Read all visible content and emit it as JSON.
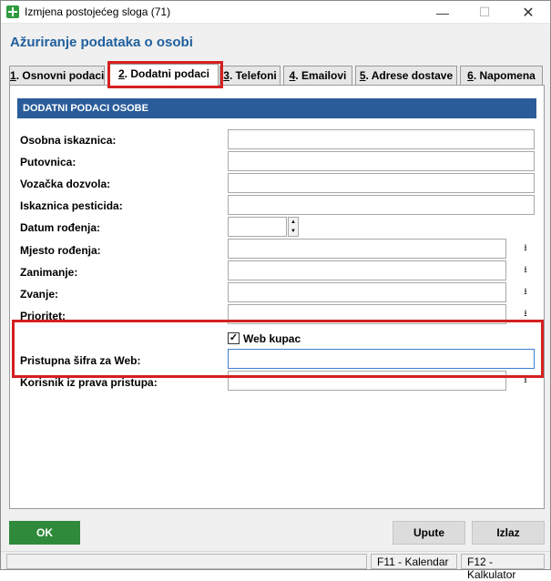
{
  "window": {
    "title": "Izmjena postojećeg sloga (71)",
    "minimize": "—",
    "maximize": "☐",
    "close": "✕"
  },
  "heading": "Ažuriranje podataka o osobi",
  "tabs": [
    {
      "key": "1",
      "label": ". Osnovni podaci"
    },
    {
      "key": "2",
      "label": ". Dodatni podaci"
    },
    {
      "key": "3",
      "label": ". Telefoni"
    },
    {
      "key": "4",
      "label": ". Emailovi"
    },
    {
      "key": "5",
      "label": ". Adrese dostave"
    },
    {
      "key": "6",
      "label": ". Napomena"
    }
  ],
  "section": {
    "title": "DODATNI PODACI OSOBE"
  },
  "fields": {
    "osobna": {
      "label": "Osobna iskaznica:",
      "value": ""
    },
    "putovnica": {
      "label": "Putovnica:",
      "value": ""
    },
    "vozacka": {
      "label": "Vozačka dozvola:",
      "value": ""
    },
    "pesticidi": {
      "label": "Iskaznica pesticida:",
      "value": ""
    },
    "datum": {
      "label": "Datum rođenja:",
      "value": ""
    },
    "mjesto": {
      "label": "Mjesto rođenja:",
      "value": ""
    },
    "zanimanje": {
      "label": "Zanimanje:",
      "value": ""
    },
    "zvanje": {
      "label": "Zvanje:",
      "value": ""
    },
    "prioritet": {
      "label": "Prioritet:",
      "value": ""
    },
    "web_kupac": {
      "label": "Web kupac",
      "checked": true,
      "mark": "✓"
    },
    "sifra": {
      "label": "Pristupna šifra za Web:",
      "value": ""
    },
    "korisnik": {
      "label": "Korisnik iz prava pristupa:",
      "value": ""
    }
  },
  "icons": {
    "combo": "⭳",
    "spin_up": "▲",
    "spin_down": "▼"
  },
  "buttons": {
    "ok": "OK",
    "upute": "Upute",
    "izlaz": "Izlaz"
  },
  "status": {
    "f11": "F11 - Kalendar",
    "f12": "F12 - Kalkulator"
  },
  "colors": {
    "accent": "#2a5c9a",
    "ok": "#2f8a3c",
    "highlight": "#d42020"
  }
}
